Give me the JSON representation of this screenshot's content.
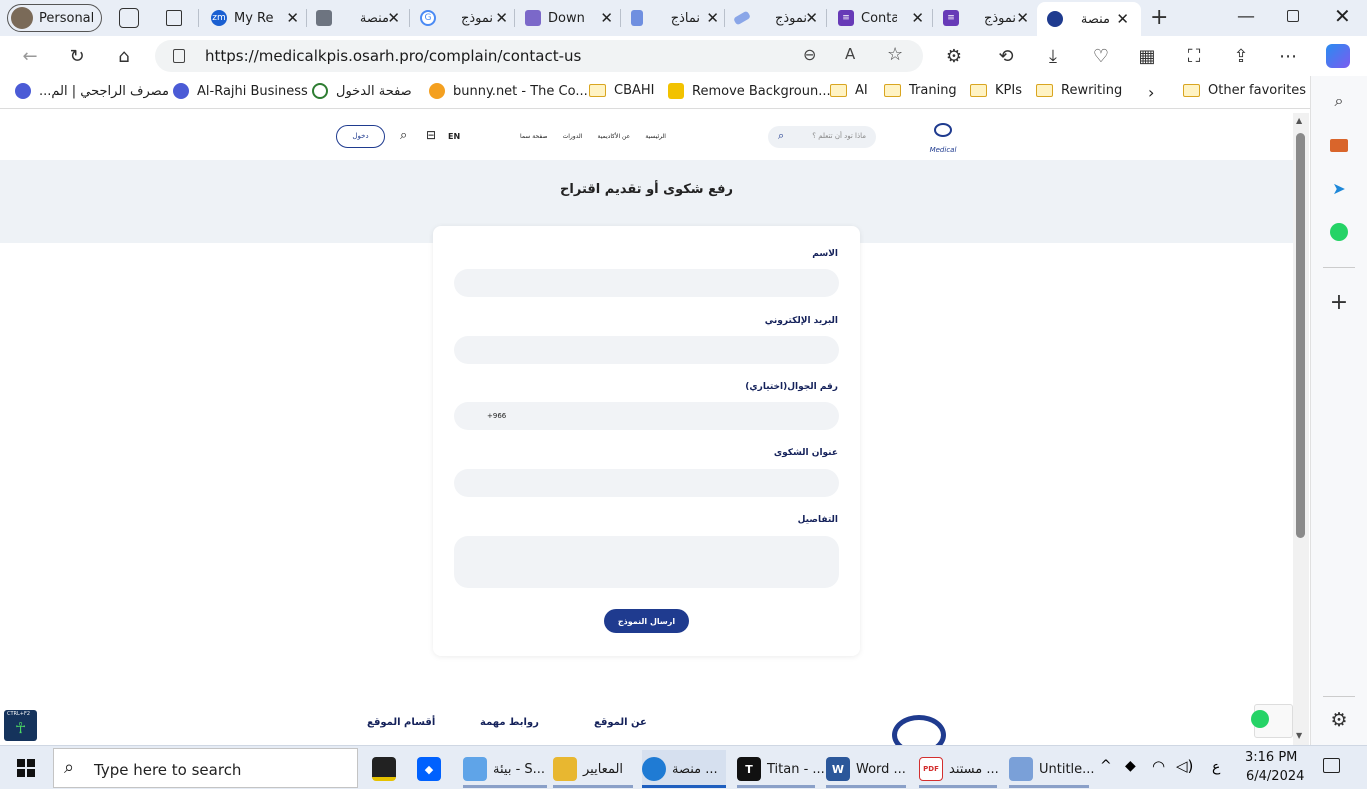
{
  "browser": {
    "profile_label": "Personal",
    "tabs": [
      {
        "title": "My Re",
        "color": "#1a5fd1",
        "glyph": "zm"
      },
      {
        "title": "منصة",
        "color": "#6d7480",
        "glyph": ""
      },
      {
        "title": "نموذج",
        "color": "#4a8af4",
        "glyph": "G"
      },
      {
        "title": "Downl",
        "color": "#7b68c9",
        "glyph": ""
      },
      {
        "title": "نماذج",
        "color": "#6f8fe0",
        "glyph": ""
      },
      {
        "title": "نموذج",
        "color": "#8aa6e8",
        "glyph": ""
      },
      {
        "title": "Conta",
        "color": "#673ab7",
        "glyph": ""
      },
      {
        "title": "نموذج",
        "color": "#673ab7",
        "glyph": ""
      },
      {
        "title": "منصة",
        "color": "#1f3b8f",
        "glyph": ""
      }
    ],
    "url": "https://medicalkpis.osarh.pro/complain/contact-us",
    "bookmarks": [
      {
        "label": "مصرف الراجحي | الم...",
        "type": "icon",
        "color": "#4b5bd6"
      },
      {
        "label": "Al-Rajhi Business",
        "type": "icon",
        "color": "#4b5bd6"
      },
      {
        "label": "صفحة الدخول",
        "type": "icon",
        "color": "#2e7d32"
      },
      {
        "label": "bunny.net - The Co...",
        "type": "icon",
        "color": "#f4a020"
      },
      {
        "label": "CBAHI",
        "type": "folder"
      },
      {
        "label": "Remove Backgroun...",
        "type": "icon",
        "color": "#f2c200"
      },
      {
        "label": "AI",
        "type": "folder"
      },
      {
        "label": "Traning",
        "type": "folder"
      },
      {
        "label": "KPIs",
        "type": "folder"
      },
      {
        "label": "Rewriting",
        "type": "folder"
      },
      {
        "label": "Other favorites",
        "type": "folder"
      }
    ]
  },
  "site": {
    "logo_text": "Medical",
    "search_placeholder": "ماذا تود أن تتعلم ؟",
    "nav": [
      "الرئيسية",
      "عن الأكاديمية",
      "الدورات",
      "صفحة سما"
    ],
    "lang": "EN",
    "login_label": "دخول",
    "hero_title": "رفع شكوى أو تقديم اقتراح",
    "form": {
      "name_label": "الاسم",
      "email_label": "البريد الإلكتروني",
      "phone_label": "رقم الجوال(اختياري)",
      "phone_prefix": "+966",
      "subject_label": "عنوان الشكوى",
      "details_label": "التفاصيل",
      "submit_label": "ارسال النموذج"
    },
    "footer": [
      "أقسام الموقع",
      "روابط مهمة",
      "عن الموقع"
    ],
    "accessibility_badge": "CTRL+F2"
  },
  "taskbar": {
    "search_placeholder": "Type here to search",
    "apps": [
      {
        "label": "",
        "color": "#222"
      },
      {
        "label": "",
        "color": "#0061fe"
      },
      {
        "label": "بيئة - S...",
        "color": "#5fa4e8"
      },
      {
        "label": "المعايير",
        "color": "#e8b730"
      },
      {
        "label": "منصة ...",
        "color": "#1f7bd4"
      },
      {
        "label": "Titan - ...",
        "color": "#111"
      },
      {
        "label": "Word ...",
        "color": "#2b579a"
      },
      {
        "label": "مستند ...",
        "color": "#d32f2f"
      },
      {
        "label": "Untitle...",
        "color": "#7aa0d8"
      }
    ],
    "ime_char": "ع",
    "time": "3:16 PM",
    "date": "6/4/2024"
  }
}
